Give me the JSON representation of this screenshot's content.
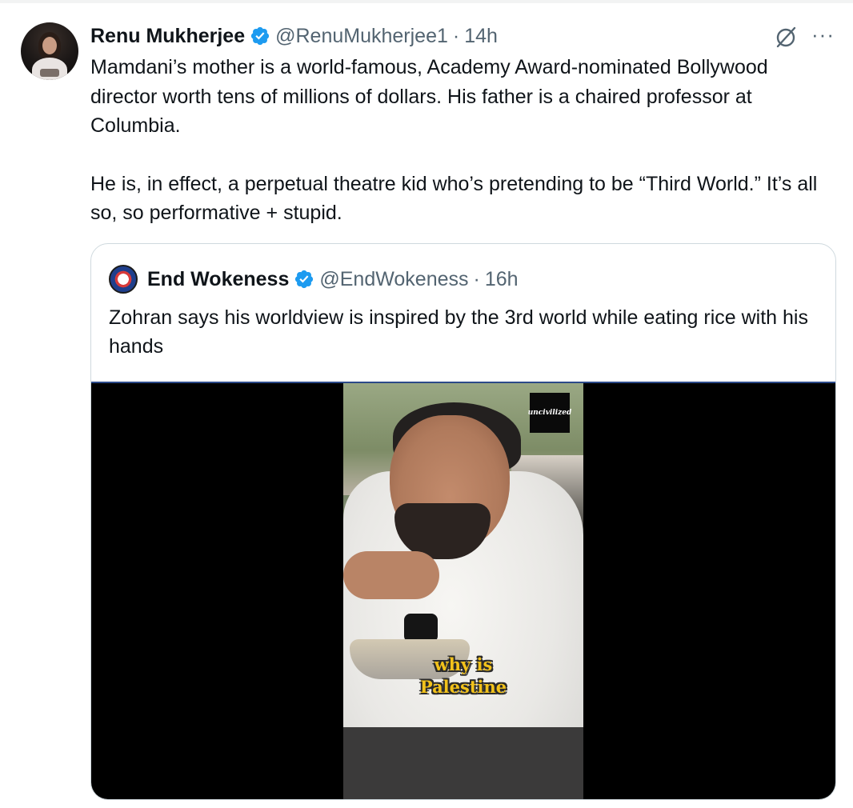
{
  "tweet": {
    "author": {
      "display_name": "Renu Mukherjee",
      "handle": "@RenuMukherjee1",
      "time": "14h",
      "verified": true
    },
    "separator": "·",
    "paragraphs": [
      "Mamdani’s mother is a world-famous, Academy Award-nominated Bollywood director worth tens of millions of dollars. His father is a chaired professor at Columbia.",
      "He is, in effect, a perpetual theatre kid who’s pretending to be “Third World.” It’s all so, so performative + stupid."
    ],
    "icons": {
      "grok": "grok-icon",
      "more": "more-icon"
    },
    "more_label": "···"
  },
  "quote": {
    "author": {
      "display_name": "End Wokeness",
      "handle": "@EndWokeness",
      "time": "16h",
      "verified": true
    },
    "separator": "·",
    "text": "Zohran says his worldview is inspired by the 3rd world while eating rice with his hands",
    "video": {
      "watermark": "uncivilized",
      "caption_line1": "why is",
      "caption_line2": "Palestine"
    }
  },
  "colors": {
    "verified_blue": "#1d9bf0",
    "secondary_text": "#536471",
    "caption_yellow": "#f2c21b",
    "border": "#cfd9de"
  }
}
